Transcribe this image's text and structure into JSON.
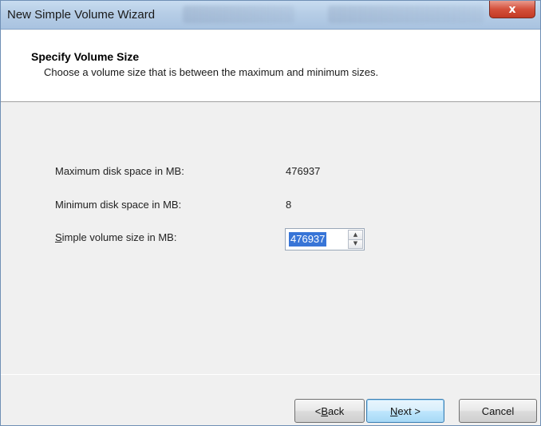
{
  "window": {
    "title": "New Simple Volume Wizard",
    "close_label": "x"
  },
  "header": {
    "title": "Specify Volume Size",
    "subtitle": "Choose a volume size that is between the maximum and minimum sizes."
  },
  "fields": {
    "max_label": "Maximum disk space in MB:",
    "max_value": "476937",
    "min_label": "Minimum disk space in MB:",
    "min_value": "8",
    "size_label_prefix": "S",
    "size_label_rest": "imple volume size in MB:",
    "size_value": "476937"
  },
  "buttons": {
    "back_prefix": "< ",
    "back_accel": "B",
    "back_rest": "ack",
    "next_accel": "N",
    "next_rest": "ext >",
    "cancel": "Cancel"
  },
  "icons": {
    "spin_up": "spin-up-arrow-icon",
    "spin_down": "spin-down-arrow-icon"
  }
}
